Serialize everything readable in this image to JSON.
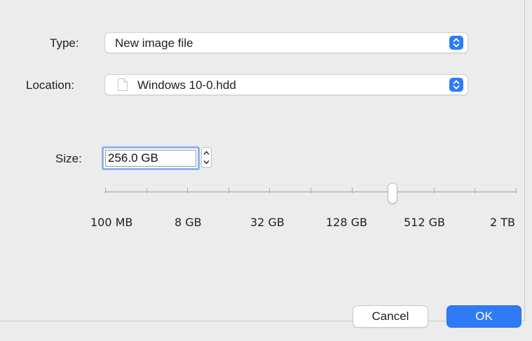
{
  "dialog": {
    "type": {
      "label": "Type:",
      "value": "New image file"
    },
    "location": {
      "label": "Location:",
      "value": "Windows 10-0.hdd",
      "icon": "document-icon"
    },
    "size": {
      "label": "Size:",
      "value": "256.0 GB"
    },
    "slider": {
      "tick_labels": [
        "100 MB",
        "8 GB",
        "32 GB",
        "128 GB",
        "512 GB",
        "2 TB"
      ],
      "tick_count": 11,
      "selected_value": "256.0 GB",
      "level_fraction": 0.7
    },
    "buttons": {
      "cancel": "Cancel",
      "ok": "OK"
    }
  },
  "colors": {
    "accent": "#2f7bf6",
    "background": "#ececec",
    "focus_ring": "#8fb2ef"
  }
}
